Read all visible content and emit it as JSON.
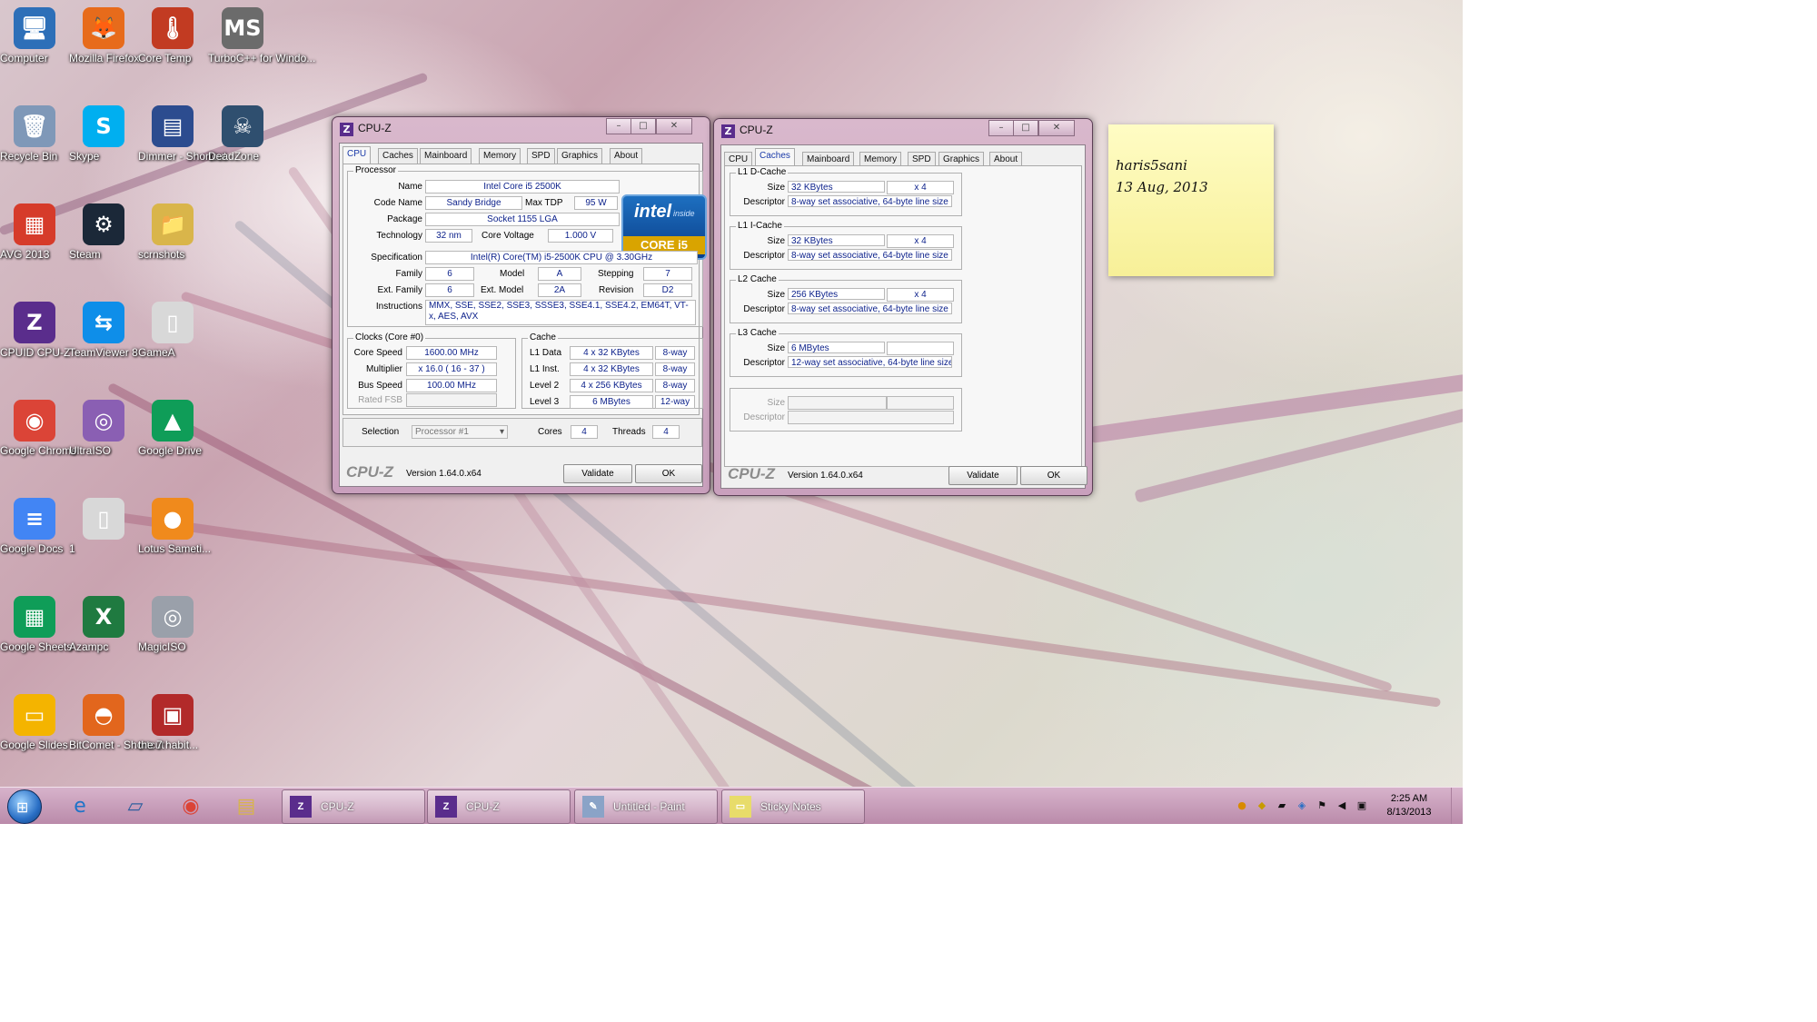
{
  "desktop": {
    "icons": [
      {
        "label": "Computer",
        "glyph": "🖥",
        "color": "#2d6fb8"
      },
      {
        "label": "Mozilla Firefox",
        "glyph": "🦊",
        "color": "#e76b1b"
      },
      {
        "label": "Core Temp",
        "glyph": "🌡",
        "color": "#c23b22"
      },
      {
        "label": "TurboC++ for Windo...",
        "glyph": "MS",
        "color": "#6b6b6b"
      },
      {
        "label": "Recycle Bin",
        "glyph": "🗑",
        "color": "#7f98b8"
      },
      {
        "label": "Skype",
        "glyph": "S",
        "color": "#00aff0"
      },
      {
        "label": "Dimmer - Shortcut",
        "glyph": "▤",
        "color": "#2c4c8f"
      },
      {
        "label": "DeadZone",
        "glyph": "☠",
        "color": "#2f4f6f"
      },
      {
        "label": "AVG 2013",
        "glyph": "▦",
        "color": "#d63b2a"
      },
      {
        "label": "Steam",
        "glyph": "⚙",
        "color": "#1b2838"
      },
      {
        "label": "scrnshots",
        "glyph": "📁",
        "color": "#d9b54a"
      },
      {
        "label": "CPUID CPU-Z",
        "glyph": "Z",
        "color": "#5a2d8c"
      },
      {
        "label": "TeamViewer 8",
        "glyph": "⇆",
        "color": "#0e8ee9"
      },
      {
        "label": "GameA",
        "glyph": "▯",
        "color": "#d8d8d8"
      },
      {
        "label": "Google Chrome",
        "glyph": "◉",
        "color": "#db4437"
      },
      {
        "label": "UltraISO",
        "glyph": "◎",
        "color": "#8a5fb3"
      },
      {
        "label": "Google Drive",
        "glyph": "▲",
        "color": "#0f9d58"
      },
      {
        "label": "Google Docs",
        "glyph": "≡",
        "color": "#4285f4"
      },
      {
        "label": "1",
        "glyph": "▯",
        "color": "#d8d8d8"
      },
      {
        "label": "Lotus Sameti...",
        "glyph": "●",
        "color": "#f08a1c"
      },
      {
        "label": "Google Sheets",
        "glyph": "▦",
        "color": "#0f9d58"
      },
      {
        "label": "Azampc",
        "glyph": "X",
        "color": "#1f7a40"
      },
      {
        "label": "MagicISO",
        "glyph": "◎",
        "color": "#9aa0aa"
      },
      {
        "label": "Google Slides",
        "glyph": "▭",
        "color": "#f4b400"
      },
      {
        "label": "BitComet - Shortcut",
        "glyph": "◓",
        "color": "#e2661d"
      },
      {
        "label": "the 7 habit...",
        "glyph": "▣",
        "color": "#b22a2a"
      }
    ]
  },
  "cpuz_left": {
    "title": "CPU-Z",
    "tabs": [
      "CPU",
      "Caches",
      "Mainboard",
      "Memory",
      "SPD",
      "Graphics",
      "About"
    ],
    "active_tab": "CPU",
    "processor": {
      "group": "Processor",
      "name_label": "Name",
      "name": "Intel Core i5 2500K",
      "codename_label": "Code Name",
      "codename": "Sandy Bridge",
      "maxtdp_label": "Max TDP",
      "maxtdp": "95 W",
      "package_label": "Package",
      "package": "Socket 1155 LGA",
      "technology_label": "Technology",
      "technology": "32 nm",
      "voltage_label": "Core Voltage",
      "voltage": "1.000 V",
      "spec_label": "Specification",
      "spec": "Intel(R) Core(TM) i5-2500K CPU @ 3.30GHz",
      "family_label": "Family",
      "family": "6",
      "model_label": "Model",
      "model": "A",
      "stepping_label": "Stepping",
      "stepping": "7",
      "extfamily_label": "Ext. Family",
      "extfamily": "6",
      "extmodel_label": "Ext. Model",
      "extmodel": "2A",
      "revision_label": "Revision",
      "revision": "D2",
      "instructions_label": "Instructions",
      "instructions": "MMX, SSE, SSE2, SSE3, SSSE3, SSE4.1, SSE4.2, EM64T, VT-x, AES, AVX"
    },
    "intel_logo": {
      "brand": "intel",
      "inside": "inside",
      "core": "CORE i5"
    },
    "clocks": {
      "group": "Clocks (Core #0)",
      "corespeed_label": "Core Speed",
      "corespeed": "1600.00 MHz",
      "multiplier_label": "Multiplier",
      "multiplier": "x 16.0 ( 16 - 37 )",
      "busspeed_label": "Bus Speed",
      "busspeed": "100.00 MHz",
      "ratedfsb_label": "Rated FSB",
      "ratedfsb": ""
    },
    "cache": {
      "group": "Cache",
      "rows": [
        {
          "label": "L1 Data",
          "size": "4 x 32 KBytes",
          "way": "8-way"
        },
        {
          "label": "L1 Inst.",
          "size": "4 x 32 KBytes",
          "way": "8-way"
        },
        {
          "label": "Level 2",
          "size": "4 x 256 KBytes",
          "way": "8-way"
        },
        {
          "label": "Level 3",
          "size": "6 MBytes",
          "way": "12-way"
        }
      ]
    },
    "selection_label": "Selection",
    "selection": "Processor #1",
    "cores_label": "Cores",
    "cores": "4",
    "threads_label": "Threads",
    "threads": "4",
    "brand": "CPU-Z",
    "version": "Version 1.64.0.x64",
    "validate": "Validate",
    "ok": "OK"
  },
  "cpuz_right": {
    "title": "CPU-Z",
    "tabs": [
      "CPU",
      "Caches",
      "Mainboard",
      "Memory",
      "SPD",
      "Graphics",
      "About"
    ],
    "active_tab": "Caches",
    "size_label": "Size",
    "descriptor_label": "Descriptor",
    "groups": [
      {
        "name": "L1 D-Cache",
        "size": "32 KBytes",
        "count": "x 4",
        "descriptor": "8-way set associative, 64-byte line size"
      },
      {
        "name": "L1 I-Cache",
        "size": "32 KBytes",
        "count": "x 4",
        "descriptor": "8-way set associative, 64-byte line size"
      },
      {
        "name": "L2 Cache",
        "size": "256 KBytes",
        "count": "x 4",
        "descriptor": "8-way set associative, 64-byte line size"
      },
      {
        "name": "L3 Cache",
        "size": "6 MBytes",
        "count": "",
        "descriptor": "12-way set associative, 64-byte line size"
      }
    ],
    "brand": "CPU-Z",
    "version": "Version 1.64.0.x64",
    "validate": "Validate",
    "ok": "OK"
  },
  "sticky": {
    "line1": "haris5sani",
    "line2": "13 Aug, 2013"
  },
  "taskbar": {
    "pinned": [
      {
        "name": "internet-explorer",
        "glyph": "e",
        "color": "#1e73c8"
      },
      {
        "name": "app-launcher",
        "glyph": "▱",
        "color": "#2f5f9f"
      },
      {
        "name": "google-chrome",
        "glyph": "◉",
        "color": "#db4437"
      },
      {
        "name": "file-explorer",
        "glyph": "▤",
        "color": "#d8b44a"
      }
    ],
    "buttons": [
      {
        "label": "CPU-Z",
        "icon": "Z",
        "color": "#5a2d8c"
      },
      {
        "label": "CPU-Z",
        "icon": "Z",
        "color": "#5a2d8c"
      },
      {
        "label": "Untitled - Paint",
        "icon": "✎",
        "color": "#8aa3c7"
      },
      {
        "label": "Sticky Notes",
        "icon": "▭",
        "color": "#e8dc6a"
      }
    ],
    "time": "2:25 AM",
    "date": "8/13/2013"
  }
}
